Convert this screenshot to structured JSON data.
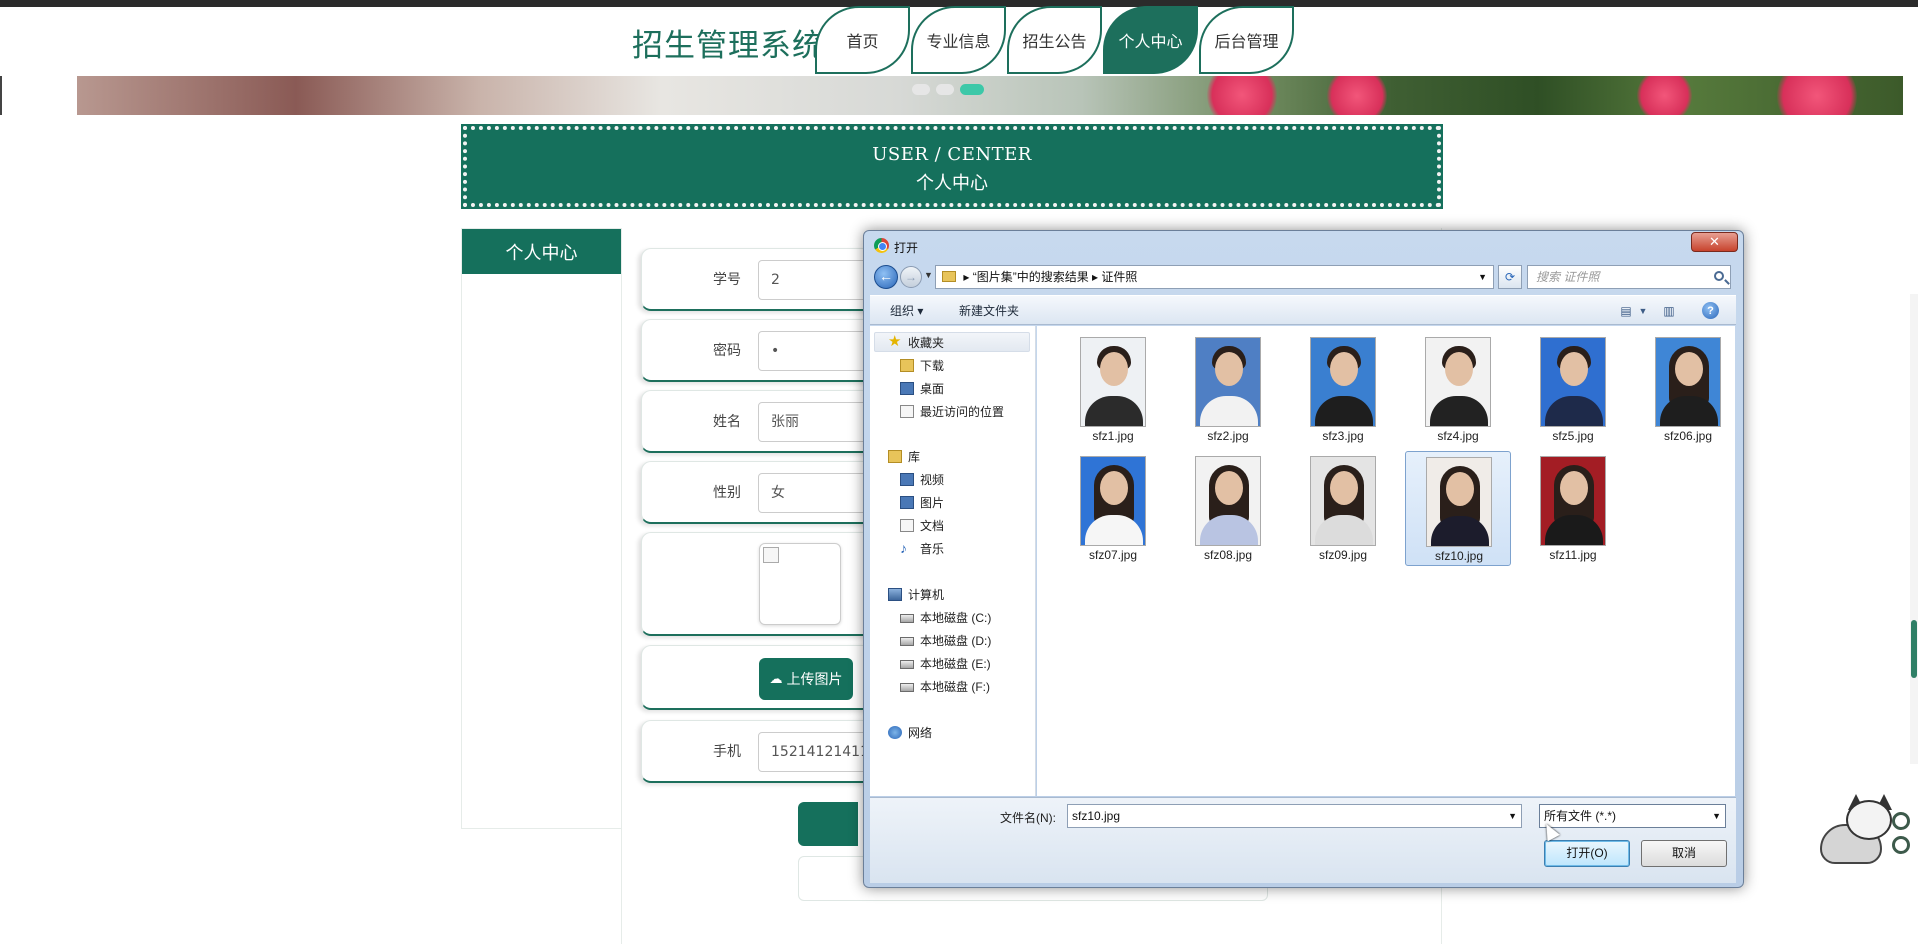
{
  "site": {
    "title": "招生管理系统",
    "nav": [
      "首页",
      "专业信息",
      "招生公告",
      "个人中心",
      "后台管理"
    ],
    "active_nav": "个人中心"
  },
  "banner": {
    "slide_count": 3,
    "active_slide": 3
  },
  "user_center": {
    "header_en": "USER / CENTER",
    "header_cn": "个人中心",
    "sidebar_title": "个人中心"
  },
  "form": {
    "student_id_label": "学号",
    "student_id_value": "2",
    "password_label": "密码",
    "password_value": "•",
    "name_label": "姓名",
    "name_value": "张丽",
    "gender_label": "性别",
    "gender_value": "女",
    "upload_label": "上传图片",
    "phone_label": "手机",
    "phone_value": "15214121411"
  },
  "dialog": {
    "title": "打开",
    "close": "✕",
    "address_parts": [
      "“图片集”中的搜索结果",
      "证件照"
    ],
    "search_placeholder": "搜索 证件照",
    "organize": "组织 ▾",
    "new_folder": "新建文件夹",
    "nav_tree": {
      "favorites": "收藏夹",
      "downloads": "下载",
      "desktop": "桌面",
      "recent": "最近访问的位置",
      "library": "库",
      "videos": "视频",
      "pictures": "图片",
      "documents": "文档",
      "music": "音乐",
      "computer": "计算机",
      "drive_c": "本地磁盘 (C:)",
      "drive_d": "本地磁盘 (D:)",
      "drive_e": "本地磁盘 (E:)",
      "drive_f": "本地磁盘 (F:)",
      "network": "网络"
    },
    "files": [
      "sfz1.jpg",
      "sfz2.jpg",
      "sfz3.jpg",
      "sfz4.jpg",
      "sfz5.jpg",
      "sfz06.jpg",
      "sfz07.jpg",
      "sfz08.jpg",
      "sfz09.jpg",
      "sfz10.jpg",
      "sfz11.jpg"
    ],
    "selected_file": "sfz10.jpg",
    "filename_label": "文件名(N):",
    "filename_value": "sfz10.jpg",
    "filetype_value": "所有文件 (*.*)",
    "open_button": "打开(O)",
    "cancel_button": "取消"
  },
  "colors": {
    "brand": "#15705c",
    "accent_dot": "#3cc8a8"
  }
}
